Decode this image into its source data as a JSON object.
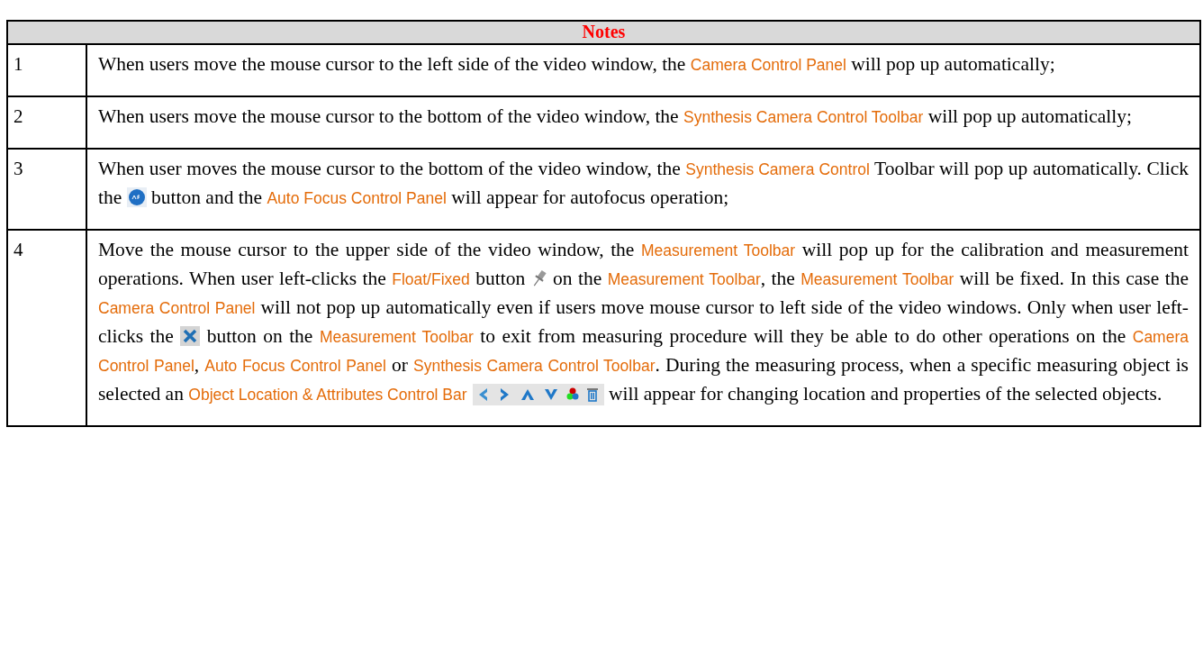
{
  "table": {
    "heading": "Notes",
    "rows": [
      {
        "number": "1",
        "segments": [
          {
            "kind": "text",
            "text": "When users move the mouse cursor to the left side of the video window, the "
          },
          {
            "kind": "term",
            "text": "Camera Control Panel"
          },
          {
            "kind": "text",
            "text": " will pop up automatically;"
          }
        ]
      },
      {
        "number": "2",
        "segments": [
          {
            "kind": "text",
            "text": "When users move the mouse cursor to the bottom of the video window, the "
          },
          {
            "kind": "term",
            "text": "Synthesis Camera Control Toolbar"
          },
          {
            "kind": "text",
            "text": " will pop up automatically;"
          }
        ]
      },
      {
        "number": "3",
        "segments": [
          {
            "kind": "text",
            "text": "When user moves the mouse cursor to the bottom of the video window, the "
          },
          {
            "kind": "term",
            "text": "Synthesis Camera Control"
          },
          {
            "kind": "text",
            "text": " Toolbar will pop up automatically. Click the "
          },
          {
            "kind": "autofocus"
          },
          {
            "kind": "text",
            "text": " button and the "
          },
          {
            "kind": "term",
            "text": "Auto Focus Control Panel"
          },
          {
            "kind": "text",
            "text": " will appear for autofocus operation;"
          }
        ]
      },
      {
        "number": "4",
        "segments": [
          {
            "kind": "text",
            "text": "Move the mouse cursor to the upper side of the video window, the "
          },
          {
            "kind": "term",
            "text": "Measurement Toolbar"
          },
          {
            "kind": "text",
            "text": " will pop up for the calibration and measurement operations. When user left-clicks the "
          },
          {
            "kind": "term",
            "text": "Float/Fixed"
          },
          {
            "kind": "text",
            "text": " button "
          },
          {
            "kind": "pin"
          },
          {
            "kind": "text",
            "text": " on the "
          },
          {
            "kind": "term",
            "text": "Measurement Toolbar"
          },
          {
            "kind": "text",
            "text": ", the "
          },
          {
            "kind": "term",
            "text": "Measurement Toolbar"
          },
          {
            "kind": "text",
            "text": " will be fixed. In this case the "
          },
          {
            "kind": "term",
            "text": "Camera Control Panel"
          },
          {
            "kind": "text",
            "text": " will not pop up automatically even if users move mouse cursor to left side of the video windows. Only when user left-clicks the "
          },
          {
            "kind": "close"
          },
          {
            "kind": "text",
            "text": " button on the "
          },
          {
            "kind": "term",
            "text": "Measurement Toolbar"
          },
          {
            "kind": "text",
            "text": " to exit from measuring procedure will they be able to do other operations on the "
          },
          {
            "kind": "term",
            "text": "Camera Control Panel"
          },
          {
            "kind": "text",
            "text": ", "
          },
          {
            "kind": "term",
            "text": "Auto Focus Control Panel"
          },
          {
            "kind": "text",
            "text": " or "
          },
          {
            "kind": "term",
            "text": "Synthesis Camera Control Toolbar"
          },
          {
            "kind": "text",
            "text": ". During the measuring process, when a specific measuring object is selected an "
          },
          {
            "kind": "term",
            "text": "Object Location & Attributes Control Bar"
          },
          {
            "kind": "toolbar"
          },
          {
            "kind": "text",
            "text": " will appear for changing location and properties of the selected objects."
          }
        ]
      }
    ]
  }
}
